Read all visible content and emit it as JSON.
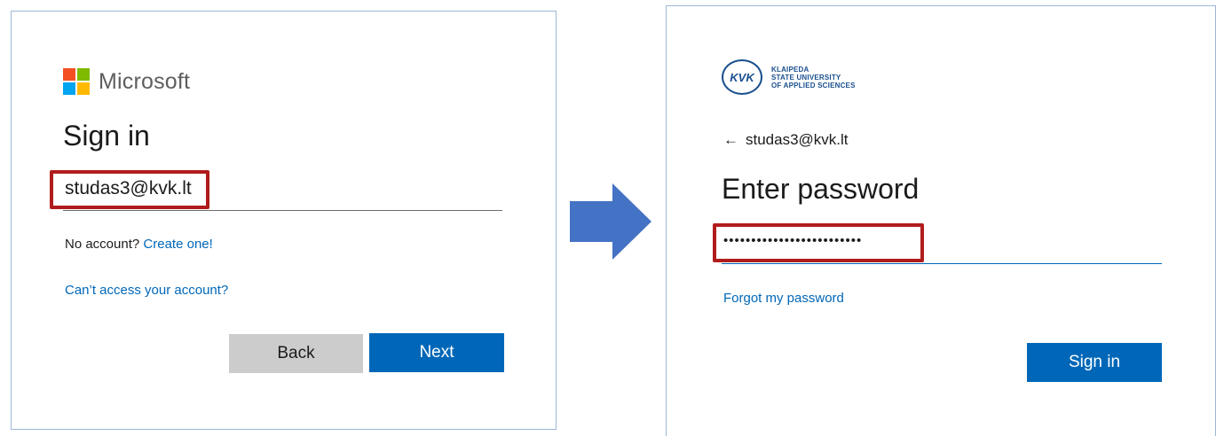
{
  "left_panel": {
    "brand": {
      "name": "Microsoft",
      "colors": [
        "#f25022",
        "#7fba00",
        "#00a4ef",
        "#ffb900"
      ]
    },
    "title": "Sign in",
    "email_value": "studas3@kvk.lt",
    "no_account_text": "No account?",
    "create_link": "Create one!",
    "cant_access_link": "Can’t access your account?",
    "back_button": "Back",
    "next_button": "Next"
  },
  "arrow": {
    "color": "#4472c4",
    "icon": "right-arrow"
  },
  "right_panel": {
    "org_logo": {
      "emblem": "KVK",
      "lines": [
        "KLAIPEDA",
        "STATE UNIVERSITY",
        "OF APPLIED SCIENCES"
      ]
    },
    "back_icon": "←",
    "account": "studas3@kvk.lt",
    "title": "Enter password",
    "password_value": "•••••••••••••••••••••••••",
    "forgot_link": "Forgot my password",
    "signin_button": "Sign in"
  },
  "colors": {
    "highlight": "#b01c1c",
    "link": "#0067b8",
    "primary_button": "#0067b8",
    "secondary_button": "#cccccc"
  }
}
